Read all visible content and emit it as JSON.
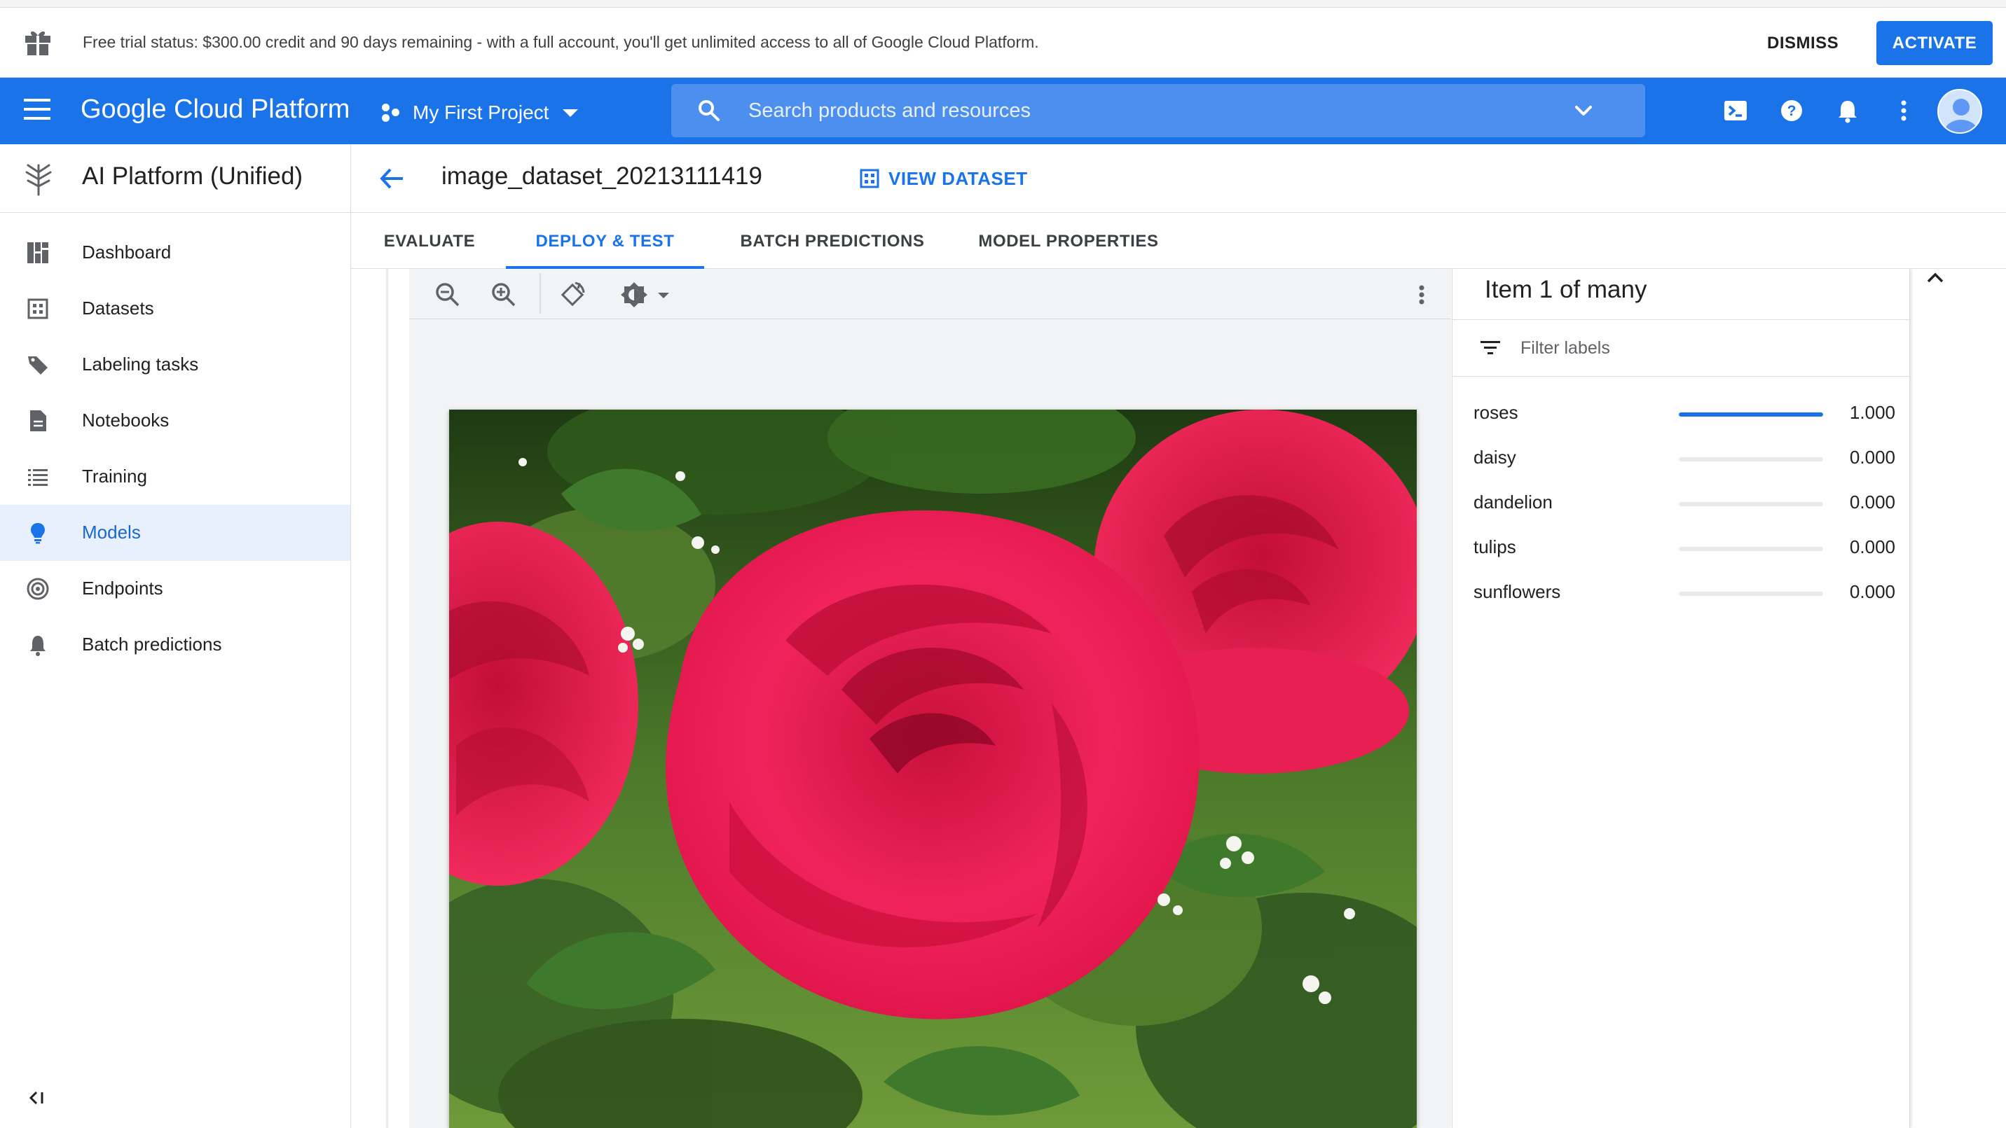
{
  "trial_banner": {
    "text": "Free trial status: $300.00 credit and 90 days remaining - with a full account, you'll get unlimited access to all of Google Cloud Platform.",
    "dismiss_label": "DISMISS",
    "activate_label": "ACTIVATE"
  },
  "header": {
    "brand": "Google Cloud Platform",
    "project": "My First Project",
    "search_placeholder": "Search products and resources",
    "icons": [
      "cloud-shell-icon",
      "help-icon",
      "notifications-icon",
      "more-vert-icon"
    ]
  },
  "sidebar": {
    "product_title": "AI Platform (Unified)",
    "items": [
      {
        "label": "Dashboard",
        "icon": "dashboard-icon"
      },
      {
        "label": "Datasets",
        "icon": "datasets-icon"
      },
      {
        "label": "Labeling tasks",
        "icon": "label-icon"
      },
      {
        "label": "Notebooks",
        "icon": "notebook-icon"
      },
      {
        "label": "Training",
        "icon": "list-icon"
      },
      {
        "label": "Models",
        "icon": "lightbulb-icon",
        "active": true
      },
      {
        "label": "Endpoints",
        "icon": "endpoints-icon"
      },
      {
        "label": "Batch predictions",
        "icon": "bell-icon"
      }
    ]
  },
  "content": {
    "dataset_title": "image_dataset_20213111419",
    "view_dataset_label": "VIEW DATASET",
    "tabs": [
      {
        "label": "EVALUATE"
      },
      {
        "label": "DEPLOY & TEST",
        "active": true
      },
      {
        "label": "BATCH PREDICTIONS"
      },
      {
        "label": "MODEL PROPERTIES"
      }
    ]
  },
  "viewer": {
    "toolbar_icons": [
      "zoom-out-icon",
      "zoom-in-icon",
      "rotate-icon",
      "brightness-icon",
      "more-vert-icon"
    ],
    "image_subject": "red roses"
  },
  "labels_panel": {
    "title": "Item 1 of many",
    "filter_placeholder": "Filter labels",
    "predictions": [
      {
        "label": "roses",
        "score": "1.000",
        "value": 1.0
      },
      {
        "label": "daisy",
        "score": "0.000",
        "value": 0.0
      },
      {
        "label": "dandelion",
        "score": "0.000",
        "value": 0.0
      },
      {
        "label": "tulips",
        "score": "0.000",
        "value": 0.0
      },
      {
        "label": "sunflowers",
        "score": "0.000",
        "value": 0.0
      }
    ]
  },
  "colors": {
    "primary": "#1a73e8",
    "active_nav_bg": "#e8f0fe",
    "rose_red": "#e8184a",
    "foliage_green": "#3d6b2a"
  }
}
